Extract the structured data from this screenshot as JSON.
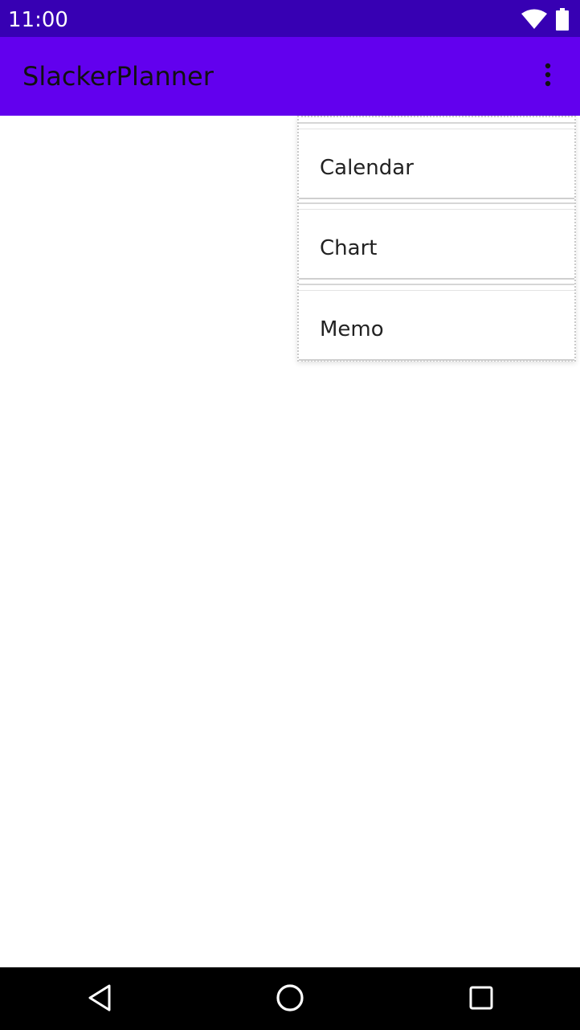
{
  "status_bar": {
    "time": "11:00",
    "icons": [
      "wifi-icon",
      "battery-icon"
    ]
  },
  "app_bar": {
    "title": "SlackerPlanner",
    "overflow_icon": "more-vert-icon"
  },
  "overflow_menu": {
    "items": [
      {
        "label": "Calendar"
      },
      {
        "label": "Chart"
      },
      {
        "label": "Memo"
      }
    ]
  },
  "nav_bar": {
    "icons": [
      "back-icon",
      "home-icon",
      "recents-icon"
    ]
  },
  "colors": {
    "status_bar": "#3700b3",
    "app_bar": "#6200ee",
    "background": "#ffffff",
    "nav_bar": "#000000"
  }
}
